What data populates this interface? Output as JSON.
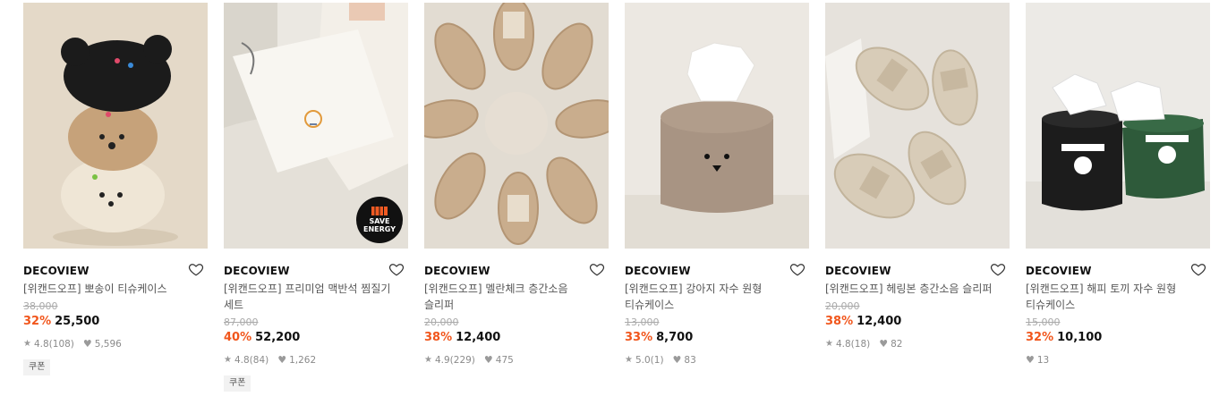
{
  "products": [
    {
      "brand": "DECOVIEW",
      "title_line1": "[위캔드오프] 뽀송이 티슈케이스",
      "title_line2": "",
      "original_price": "38,000",
      "discount": "32%",
      "price": "25,500",
      "rating": "4.8",
      "reviews": "(108)",
      "likes": "5,596",
      "badge": "쿠폰",
      "image": "poodle-stack-tissue-case"
    },
    {
      "brand": "DECOVIEW",
      "title_line1": "[위캔드오프] 프리미엄 맥반석 찜질기",
      "title_line2": "세트",
      "original_price": "87,000",
      "discount": "40%",
      "price": "52,200",
      "rating": "4.8",
      "reviews": "(84)",
      "likes": "1,262",
      "badge": "쿠폰",
      "save_badge": [
        "SAVE",
        "ENERGY"
      ],
      "image": "heating-pad"
    },
    {
      "brand": "DECOVIEW",
      "title_line1": "[위캔드오프] 멜란체크 층간소음",
      "title_line2": "슬리퍼",
      "original_price": "20,000",
      "discount": "38%",
      "price": "12,400",
      "rating": "4.9",
      "reviews": "(229)",
      "likes": "475",
      "badge": "",
      "image": "check-slippers-circle"
    },
    {
      "brand": "DECOVIEW",
      "title_line1": "[위캔드오프] 강아지 자수 원형",
      "title_line2": "티슈케이스",
      "original_price": "13,000",
      "discount": "33%",
      "price": "8,700",
      "rating": "5.0",
      "reviews": "(1)",
      "likes": "83",
      "badge": "",
      "image": "bear-tissue-case"
    },
    {
      "brand": "DECOVIEW",
      "title_line1": "[위캔드오프] 헤링본 층간소음 슬리퍼",
      "title_line2": "",
      "original_price": "20,000",
      "discount": "38%",
      "price": "12,400",
      "rating": "4.8",
      "reviews": "(18)",
      "likes": "82",
      "badge": "",
      "image": "herringbone-slippers"
    },
    {
      "brand": "DECOVIEW",
      "title_line1": "[위캔드오프] 해피 토끼 자수 원형",
      "title_line2": "티슈케이스",
      "original_price": "15,000",
      "discount": "32%",
      "price": "10,100",
      "rating": "",
      "reviews": "",
      "likes": "13",
      "badge": "",
      "image": "happy-rabbit-tissue-cases"
    }
  ],
  "colors": {
    "discount": "#f1561c",
    "brand_text": "#111111",
    "muted": "#8a8a8a"
  }
}
